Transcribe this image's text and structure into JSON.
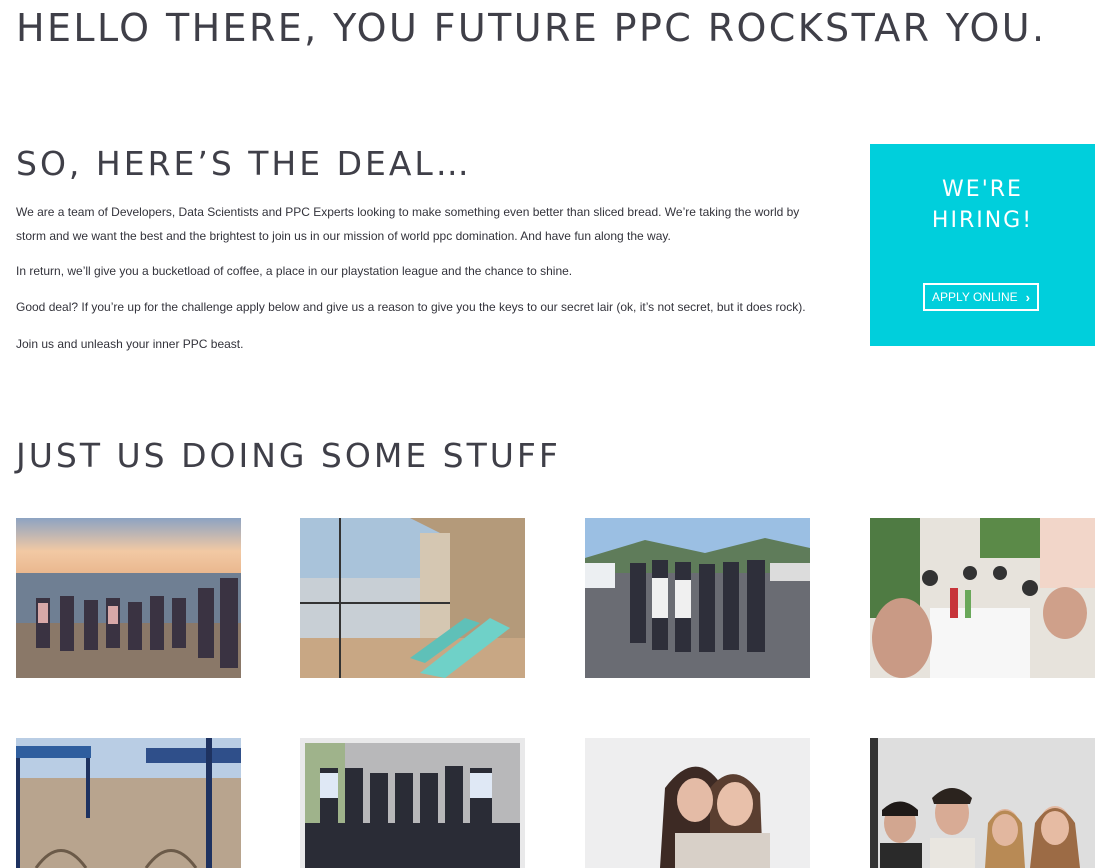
{
  "hero": {
    "title": "HELLO THERE, YOU FUTURE PPC ROCKSTAR YOU."
  },
  "deal": {
    "title": "SO, HERE’S THE DEAL…",
    "paragraphs": [
      "We are a team of Developers, Data Scientists and PPC Experts looking to make something even better than sliced bread. We’re taking the world by storm and we want the best and the brightest to join us in our mission of world ppc domination. And have fun along the way.",
      "In return, we’ll give you a bucketload of coffee, a place in our playstation league and the chance to shine.",
      "Good deal? If you’re up for the challenge apply below and give us a reason to give you the keys to our secret lair (ok, it’s not secret, but it does rock).",
      "Join us and unleash your inner PPC beast."
    ]
  },
  "hiring": {
    "line1": "WE'RE",
    "line2": "HIRING!",
    "button_label": "APPLY ONLINE",
    "button_icon": "chevron-right-icon",
    "background_color": "#00cfdc"
  },
  "gallery": {
    "title": "JUST US DOING SOME STUFF",
    "photos": [
      {
        "name": "team-on-beach-at-sunset"
      },
      {
        "name": "balcony-with-deckchairs"
      },
      {
        "name": "team-in-parking-lot"
      },
      {
        "name": "team-lunch-selfie"
      },
      {
        "name": "beach-with-umbrellas"
      },
      {
        "name": "team-group-photo"
      },
      {
        "name": "two-colleagues-hugging"
      },
      {
        "name": "four-colleagues-portrait"
      }
    ]
  }
}
